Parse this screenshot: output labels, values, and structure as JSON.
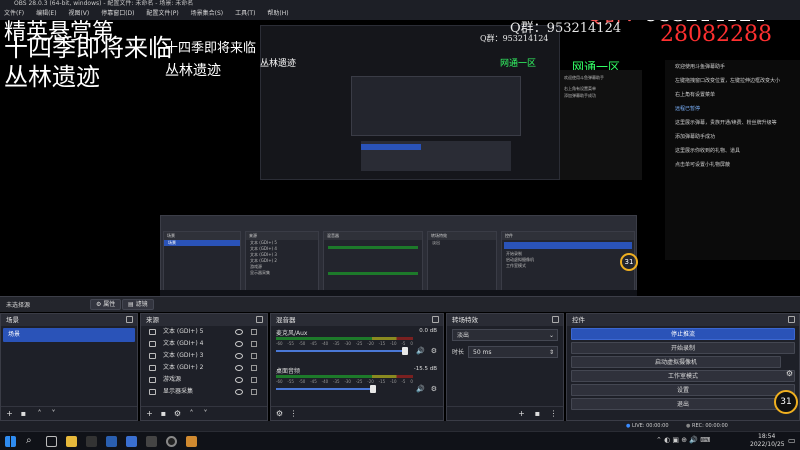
{
  "window": {
    "title": "OBS 28.0.3 (64-bit, windows) - 配置文件: 未命名 - 场景: 未命名",
    "menu": [
      "文件(F)",
      "编辑(E)",
      "视图(V)",
      "停靠窗口(D)",
      "配置文件(P)",
      "场景集合(S)",
      "工具(T)",
      "帮助(H)"
    ]
  },
  "overlay": {
    "title_line1": "精英悬赏第",
    "title_line2": "十四季即将来临",
    "title_line3": "丛林遗迹",
    "qq_label": "Q群：",
    "qq_number": "953214124",
    "qq_number2": "28082288",
    "region": "网通一区"
  },
  "chat": {
    "lines": [
      "欢迎使用斗鱼弹幕助手",
      "左键拖拽窗口改变位置，左键拉伸边框改变大小",
      "右上角有设置菜单",
      "远程已暂停",
      "这里展示弹幕，贵族开通/续费、粉丝牌升级等",
      "添加弹幕助手成功",
      "这里展示你收到的礼物、道具",
      "点击单可设置小礼物屏蔽"
    ]
  },
  "scenebar": {
    "properties_label": "属性",
    "filters_label": "滤镜",
    "no_source_label": "未选择源"
  },
  "docks": {
    "scenes": {
      "title": "场景",
      "items": [
        "场景"
      ]
    },
    "sources": {
      "title": "来源",
      "items": [
        "文本 (GDI+) 5",
        "文本 (GDI+) 4",
        "文本 (GDI+) 3",
        "文本 (GDI+) 2",
        "游戏源",
        "显示器采集"
      ]
    },
    "mixer": {
      "title": "混音器",
      "channels": [
        {
          "name": "麦克风/Aux",
          "db": "0.0 dB"
        },
        {
          "name": "桌面音频",
          "db": "-15.5 dB"
        }
      ],
      "ticks": [
        "-60",
        "-55",
        "-50",
        "-45",
        "-40",
        "-35",
        "-30",
        "-25",
        "-20",
        "-15",
        "-10",
        "-5",
        "0"
      ]
    },
    "transitions": {
      "title": "转场特效",
      "effect": "淡出",
      "duration_label": "时长",
      "duration": "50 ms"
    },
    "controls": {
      "title": "控件",
      "buttons": [
        "停止推流",
        "开始录制",
        "启动虚拟摄像机",
        "工作室模式",
        "设置",
        "退出"
      ]
    }
  },
  "statusbar": {
    "live": "LIVE: 00:00:00",
    "rec": "REC: 00:00:00"
  },
  "gauge": {
    "value": "31",
    "unit": "%"
  },
  "taskbar": {
    "time": "18:54",
    "date": "2022/10/25"
  }
}
